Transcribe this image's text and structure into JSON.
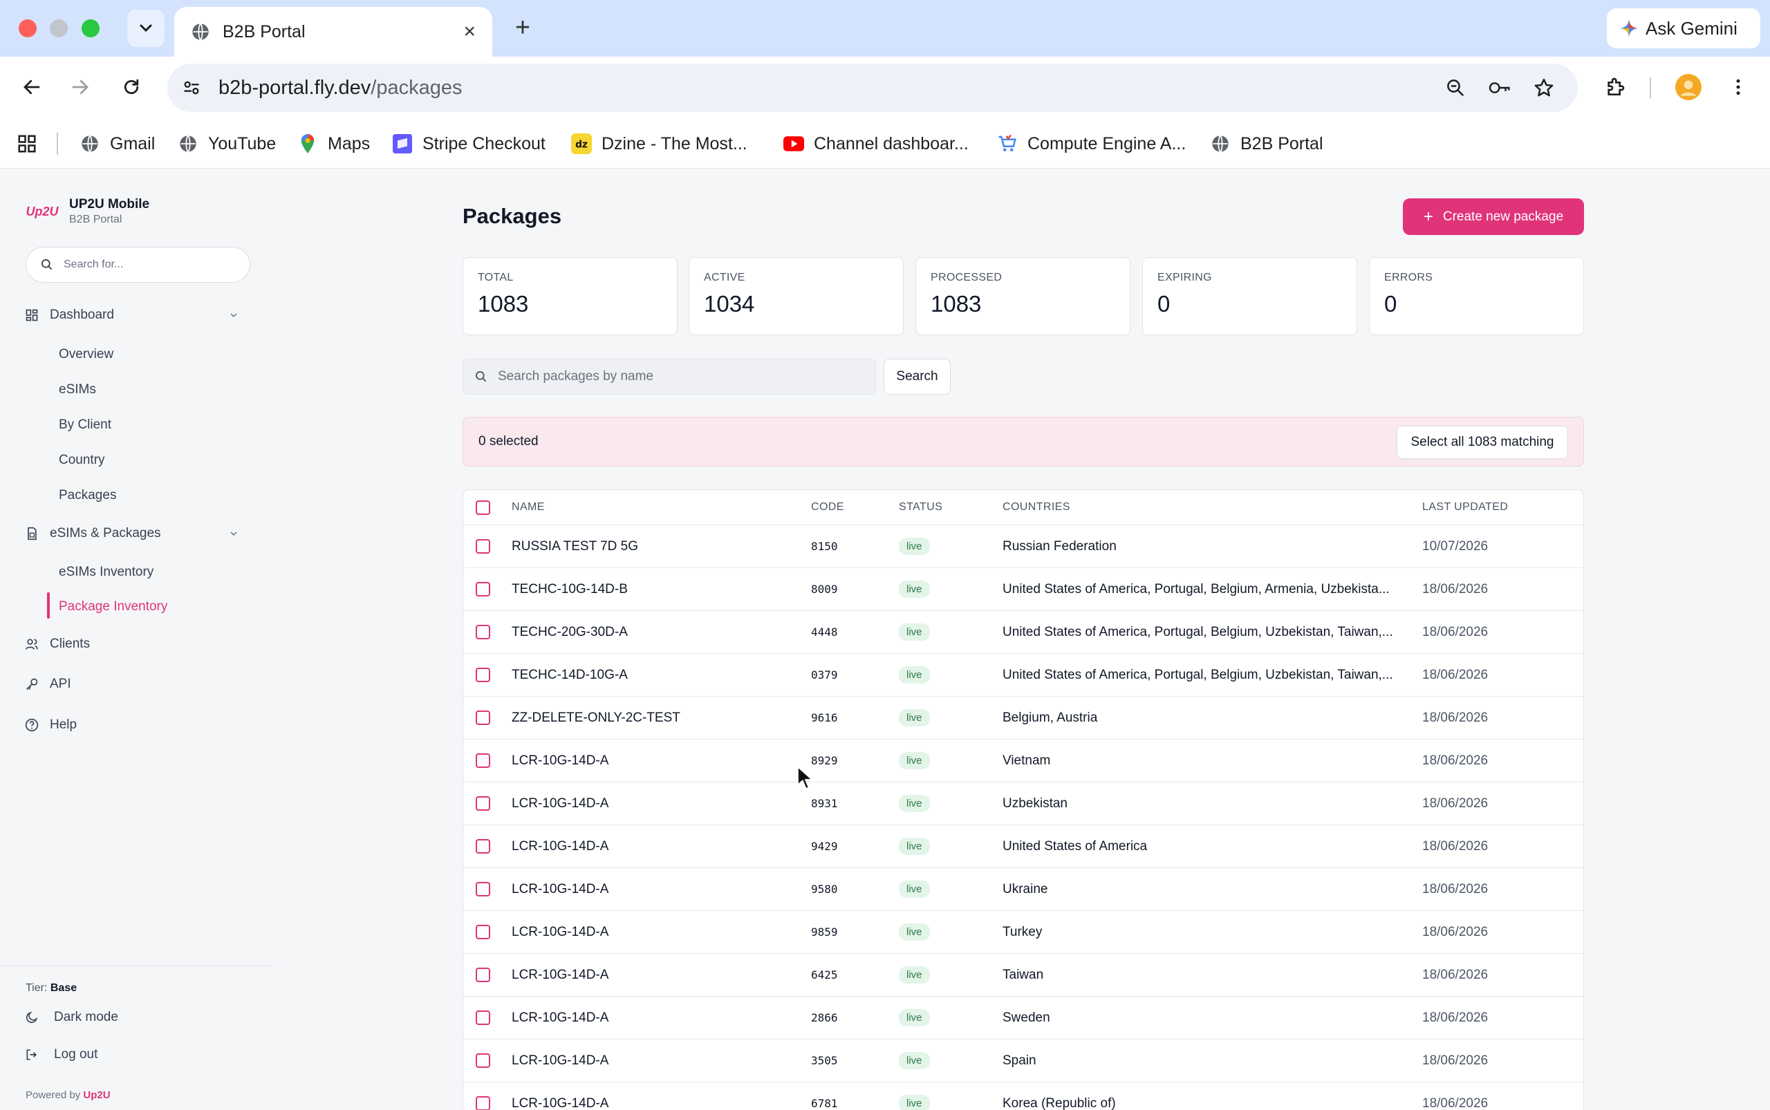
{
  "browser": {
    "tab_title": "B2B Portal",
    "url_host": "b2b-portal.fly.dev",
    "url_path": "/packages",
    "gemini_label": "Ask Gemini",
    "bookmarks": [
      {
        "label": "Gmail",
        "icon": "globe-icon"
      },
      {
        "label": "YouTube",
        "icon": "globe-icon"
      },
      {
        "label": "Maps",
        "icon": "maps-pin-icon"
      },
      {
        "label": "Stripe Checkout",
        "icon": "stripe-icon"
      },
      {
        "label": "Dzine - The Most...",
        "icon": "dzine-icon"
      },
      {
        "label": "Channel dashboar...",
        "icon": "youtube-icon"
      },
      {
        "label": "Compute Engine A...",
        "icon": "cart-icon"
      },
      {
        "label": "B2B Portal",
        "icon": "globe-icon"
      }
    ]
  },
  "sidebar": {
    "brand_name": "UP2U Mobile",
    "brand_sub": "B2B Portal",
    "brand_logo": "Up2U",
    "search_placeholder": "Search for...",
    "dashboard": {
      "label": "Dashboard",
      "items": [
        "Overview",
        "eSIMs",
        "By Client",
        "Country",
        "Packages"
      ]
    },
    "esims_packages": {
      "label": "eSIMs & Packages",
      "items": [
        "eSIMs Inventory",
        "Package Inventory"
      ]
    },
    "clients_label": "Clients",
    "api_label": "API",
    "help_label": "Help",
    "tier_label": "Tier:",
    "tier_value": "Base",
    "dark_mode_label": "Dark mode",
    "logout_label": "Log out",
    "powered_label": "Powered by",
    "powered_brand": "Up2U"
  },
  "main": {
    "title": "Packages",
    "create_button": "Create new package",
    "stats": [
      {
        "label": "TOTAL",
        "value": "1083"
      },
      {
        "label": "ACTIVE",
        "value": "1034"
      },
      {
        "label": "PROCESSED",
        "value": "1083"
      },
      {
        "label": "EXPIRING",
        "value": "0"
      },
      {
        "label": "ERRORS",
        "value": "0"
      }
    ],
    "search_placeholder": "Search packages by name",
    "search_button": "Search",
    "selected_text": "0 selected",
    "select_all_button": "Select all 1083 matching",
    "accent_color": "#e0337a",
    "table": {
      "headers": {
        "name": "NAME",
        "code": "CODE",
        "status": "STATUS",
        "countries": "COUNTRIES",
        "updated": "LAST UPDATED"
      },
      "rows": [
        {
          "name": "RUSSIA TEST 7D 5G",
          "code": "8150",
          "status": "live",
          "countries": "Russian Federation",
          "updated": "10/07/2026"
        },
        {
          "name": "TECHC-10G-14D-B",
          "code": "8009",
          "status": "live",
          "countries": "United States of America, Portugal, Belgium, Armenia, Uzbekista...",
          "updated": "18/06/2026"
        },
        {
          "name": "TECHC-20G-30D-A",
          "code": "4448",
          "status": "live",
          "countries": "United States of America, Portugal, Belgium, Uzbekistan, Taiwan,...",
          "updated": "18/06/2026"
        },
        {
          "name": "TECHC-14D-10G-A",
          "code": "0379",
          "status": "live",
          "countries": "United States of America, Portugal, Belgium, Uzbekistan, Taiwan,...",
          "updated": "18/06/2026"
        },
        {
          "name": "ZZ-DELETE-ONLY-2C-TEST",
          "code": "9616",
          "status": "live",
          "countries": "Belgium, Austria",
          "updated": "18/06/2026"
        },
        {
          "name": "LCR-10G-14D-A",
          "code": "8929",
          "status": "live",
          "countries": "Vietnam",
          "updated": "18/06/2026"
        },
        {
          "name": "LCR-10G-14D-A",
          "code": "8931",
          "status": "live",
          "countries": "Uzbekistan",
          "updated": "18/06/2026"
        },
        {
          "name": "LCR-10G-14D-A",
          "code": "9429",
          "status": "live",
          "countries": "United States of America",
          "updated": "18/06/2026"
        },
        {
          "name": "LCR-10G-14D-A",
          "code": "9580",
          "status": "live",
          "countries": "Ukraine",
          "updated": "18/06/2026"
        },
        {
          "name": "LCR-10G-14D-A",
          "code": "9859",
          "status": "live",
          "countries": "Turkey",
          "updated": "18/06/2026"
        },
        {
          "name": "LCR-10G-14D-A",
          "code": "6425",
          "status": "live",
          "countries": "Taiwan",
          "updated": "18/06/2026"
        },
        {
          "name": "LCR-10G-14D-A",
          "code": "2866",
          "status": "live",
          "countries": "Sweden",
          "updated": "18/06/2026"
        },
        {
          "name": "LCR-10G-14D-A",
          "code": "3505",
          "status": "live",
          "countries": "Spain",
          "updated": "18/06/2026"
        },
        {
          "name": "LCR-10G-14D-A",
          "code": "6781",
          "status": "live",
          "countries": "Korea (Republic of)",
          "updated": "18/06/2026"
        }
      ]
    }
  }
}
